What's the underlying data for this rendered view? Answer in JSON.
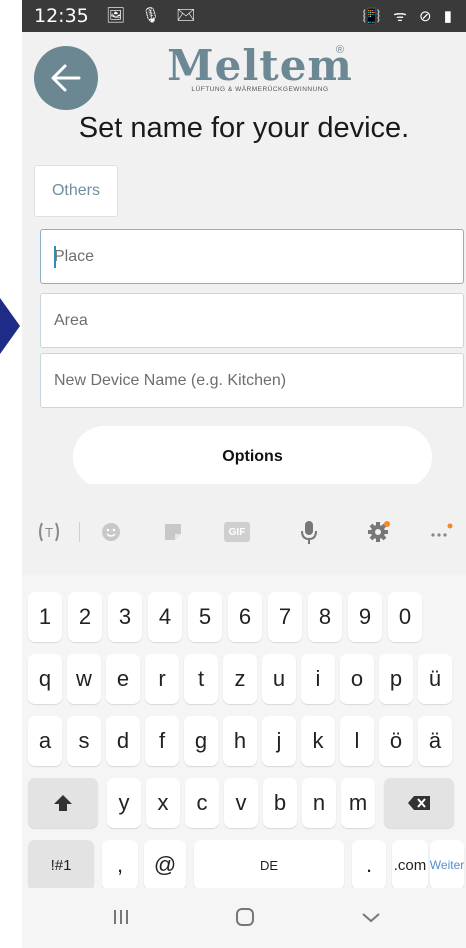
{
  "statusbar": {
    "time": "12:35",
    "left_icons": "🖼 🎙 ✉",
    "right_icons": "📳 ᯤ ⊘ ▮"
  },
  "header": {
    "logo_text": "Meltem",
    "logo_sub": "LÜFTUNG & WÄRMERÜCKGEWINNUNG",
    "logo_reg": "®"
  },
  "title": "Set name for your device.",
  "category_chip": "Others",
  "fields": {
    "place_placeholder": "Place",
    "area_placeholder": "Area",
    "name_placeholder": "New Device Name (e.g. Kitchen)"
  },
  "options_label": "Options",
  "keyboard": {
    "toolbar": [
      "translate-icon",
      "emoji-icon",
      "sticker-icon",
      "gif-icon",
      "mic-icon",
      "settings-icon",
      "more-icon"
    ],
    "gif_label": "GIF",
    "row_numbers": [
      "1",
      "2",
      "3",
      "4",
      "5",
      "6",
      "7",
      "8",
      "9",
      "0"
    ],
    "row_q": [
      "q",
      "w",
      "e",
      "r",
      "t",
      "z",
      "u",
      "i",
      "o",
      "p",
      "ü"
    ],
    "row_a": [
      "a",
      "s",
      "d",
      "f",
      "g",
      "h",
      "j",
      "k",
      "l",
      "ö",
      "ä"
    ],
    "row_y": [
      "y",
      "x",
      "c",
      "v",
      "b",
      "n",
      "m"
    ],
    "symbols_label": "!#1",
    "comma_label": ",",
    "at_label": "@",
    "space_label": "DE",
    "period_label": ".",
    "com_label": ".com",
    "enter_label": "Weiter"
  },
  "colors": {
    "accent": "#6a8792",
    "field_focus": "#8fb0c2",
    "pointer": "#1f2c87",
    "enter_text": "#4f8fd0"
  }
}
